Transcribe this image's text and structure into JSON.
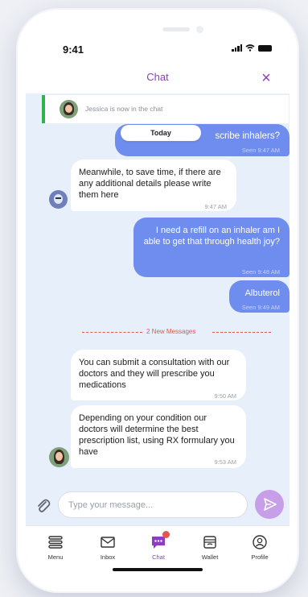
{
  "status_bar": {
    "time": "9:41"
  },
  "header": {
    "title": "Chat",
    "close_glyph": "×"
  },
  "join_notice": {
    "text": "Jessica is now in the chat"
  },
  "date_separator": "Today",
  "new_messages_divider": "2 New Messages",
  "messages": [
    {
      "direction": "out",
      "text": "scribe inhalers?",
      "meta": "Seen 9:47 AM"
    },
    {
      "direction": "in",
      "text": "Meanwhile, to save time, if there are any additional details please write them here",
      "meta": "9:47 AM"
    },
    {
      "direction": "out",
      "text": "I need a refill on an inhaler am I able to get that through health joy?",
      "meta": "Seen 9:48 AM"
    },
    {
      "direction": "out",
      "text": "Albuterol",
      "meta": "Seen 9:49 AM"
    },
    {
      "direction": "in",
      "text": "You can submit a consultation with our doctors and they will prescribe you medications",
      "meta": "9:50 AM"
    },
    {
      "direction": "in",
      "text": "Depending on your condition our doctors will determine the best prescription list, using RX formulary you have",
      "meta": "9:53 AM"
    }
  ],
  "composer": {
    "placeholder": "Type your message..."
  },
  "tabs": [
    {
      "label": "Menu",
      "icon": "menu-icon"
    },
    {
      "label": "Inbox",
      "icon": "mail-icon"
    },
    {
      "label": "Chat",
      "icon": "chat-icon",
      "active": true
    },
    {
      "label": "Wallet",
      "icon": "wallet-icon"
    },
    {
      "label": "Profile",
      "icon": "profile-icon"
    }
  ],
  "colors": {
    "accent": "#8e3cc4",
    "outgoing_bubble": "#6f8dee",
    "chat_background": "#e7effb",
    "new_messages": "#e2574c",
    "online_indicator": "#2fb34a",
    "send_button": "#c79ee8"
  }
}
